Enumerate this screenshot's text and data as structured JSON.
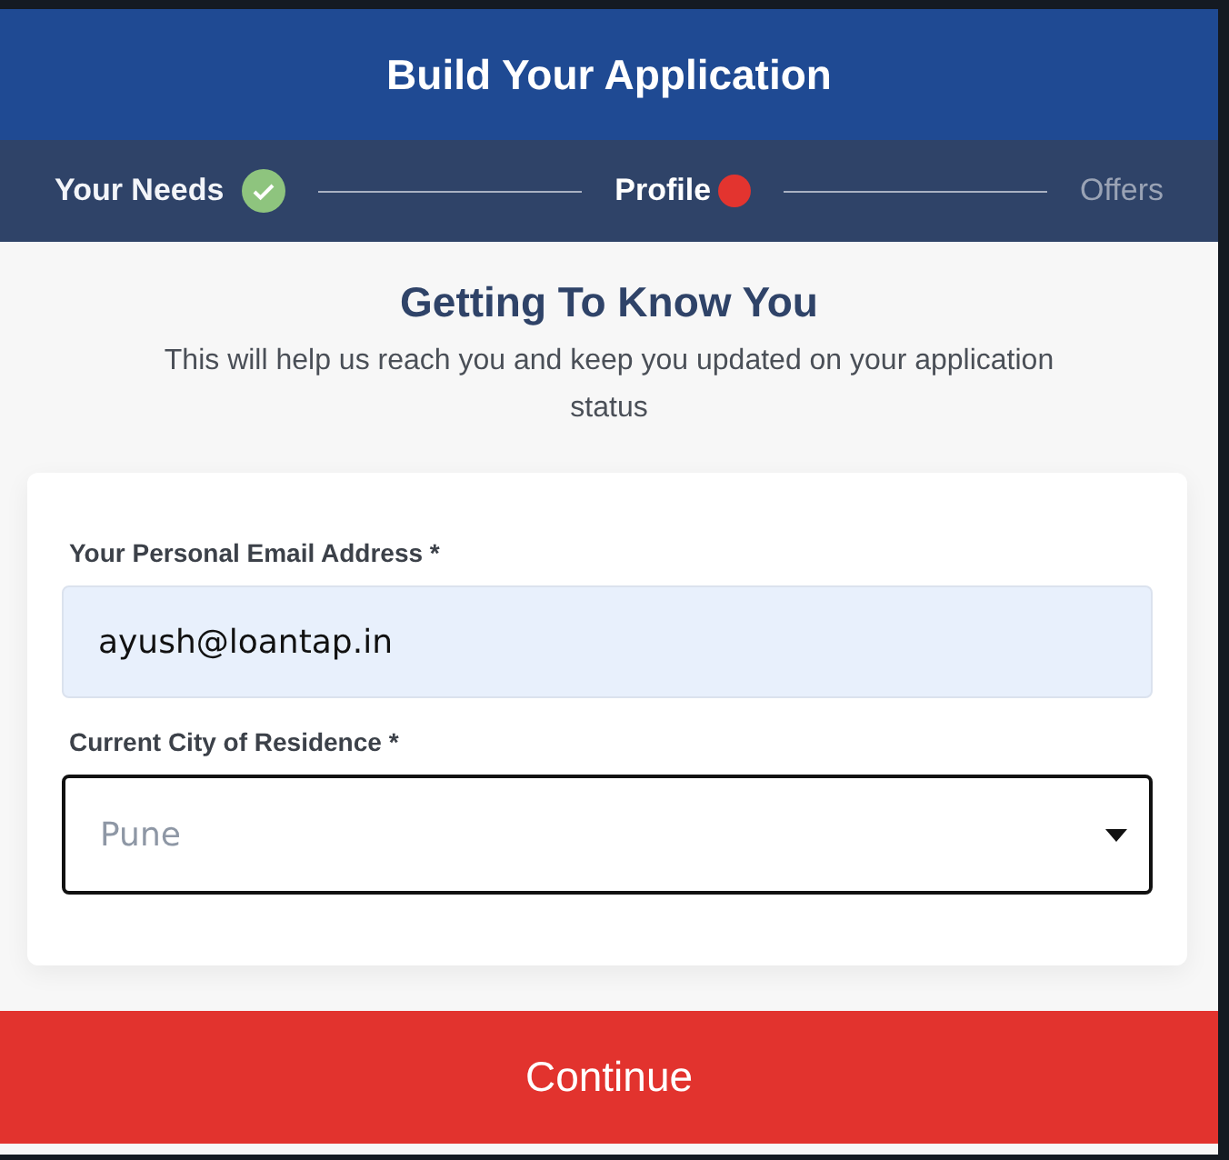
{
  "header": {
    "title": "Build Your Application"
  },
  "steps": [
    {
      "label": "Your Needs",
      "done": true,
      "selected": false
    },
    {
      "label": "Profile",
      "done": false,
      "selected": true
    },
    {
      "label": "Offers",
      "done": false,
      "selected": false
    }
  ],
  "intro": {
    "title": "Getting To Know You",
    "subtitle": "This will help us reach you and keep you updated on your application status"
  },
  "form": {
    "fields": [
      {
        "kind": "text",
        "label": "Your Personal Email Address *",
        "value": "ayush@loantap.in"
      },
      {
        "kind": "select",
        "label": "Current City of Residence *",
        "placeholder": "Pune"
      }
    ]
  },
  "button": {
    "label": "Continue"
  }
}
